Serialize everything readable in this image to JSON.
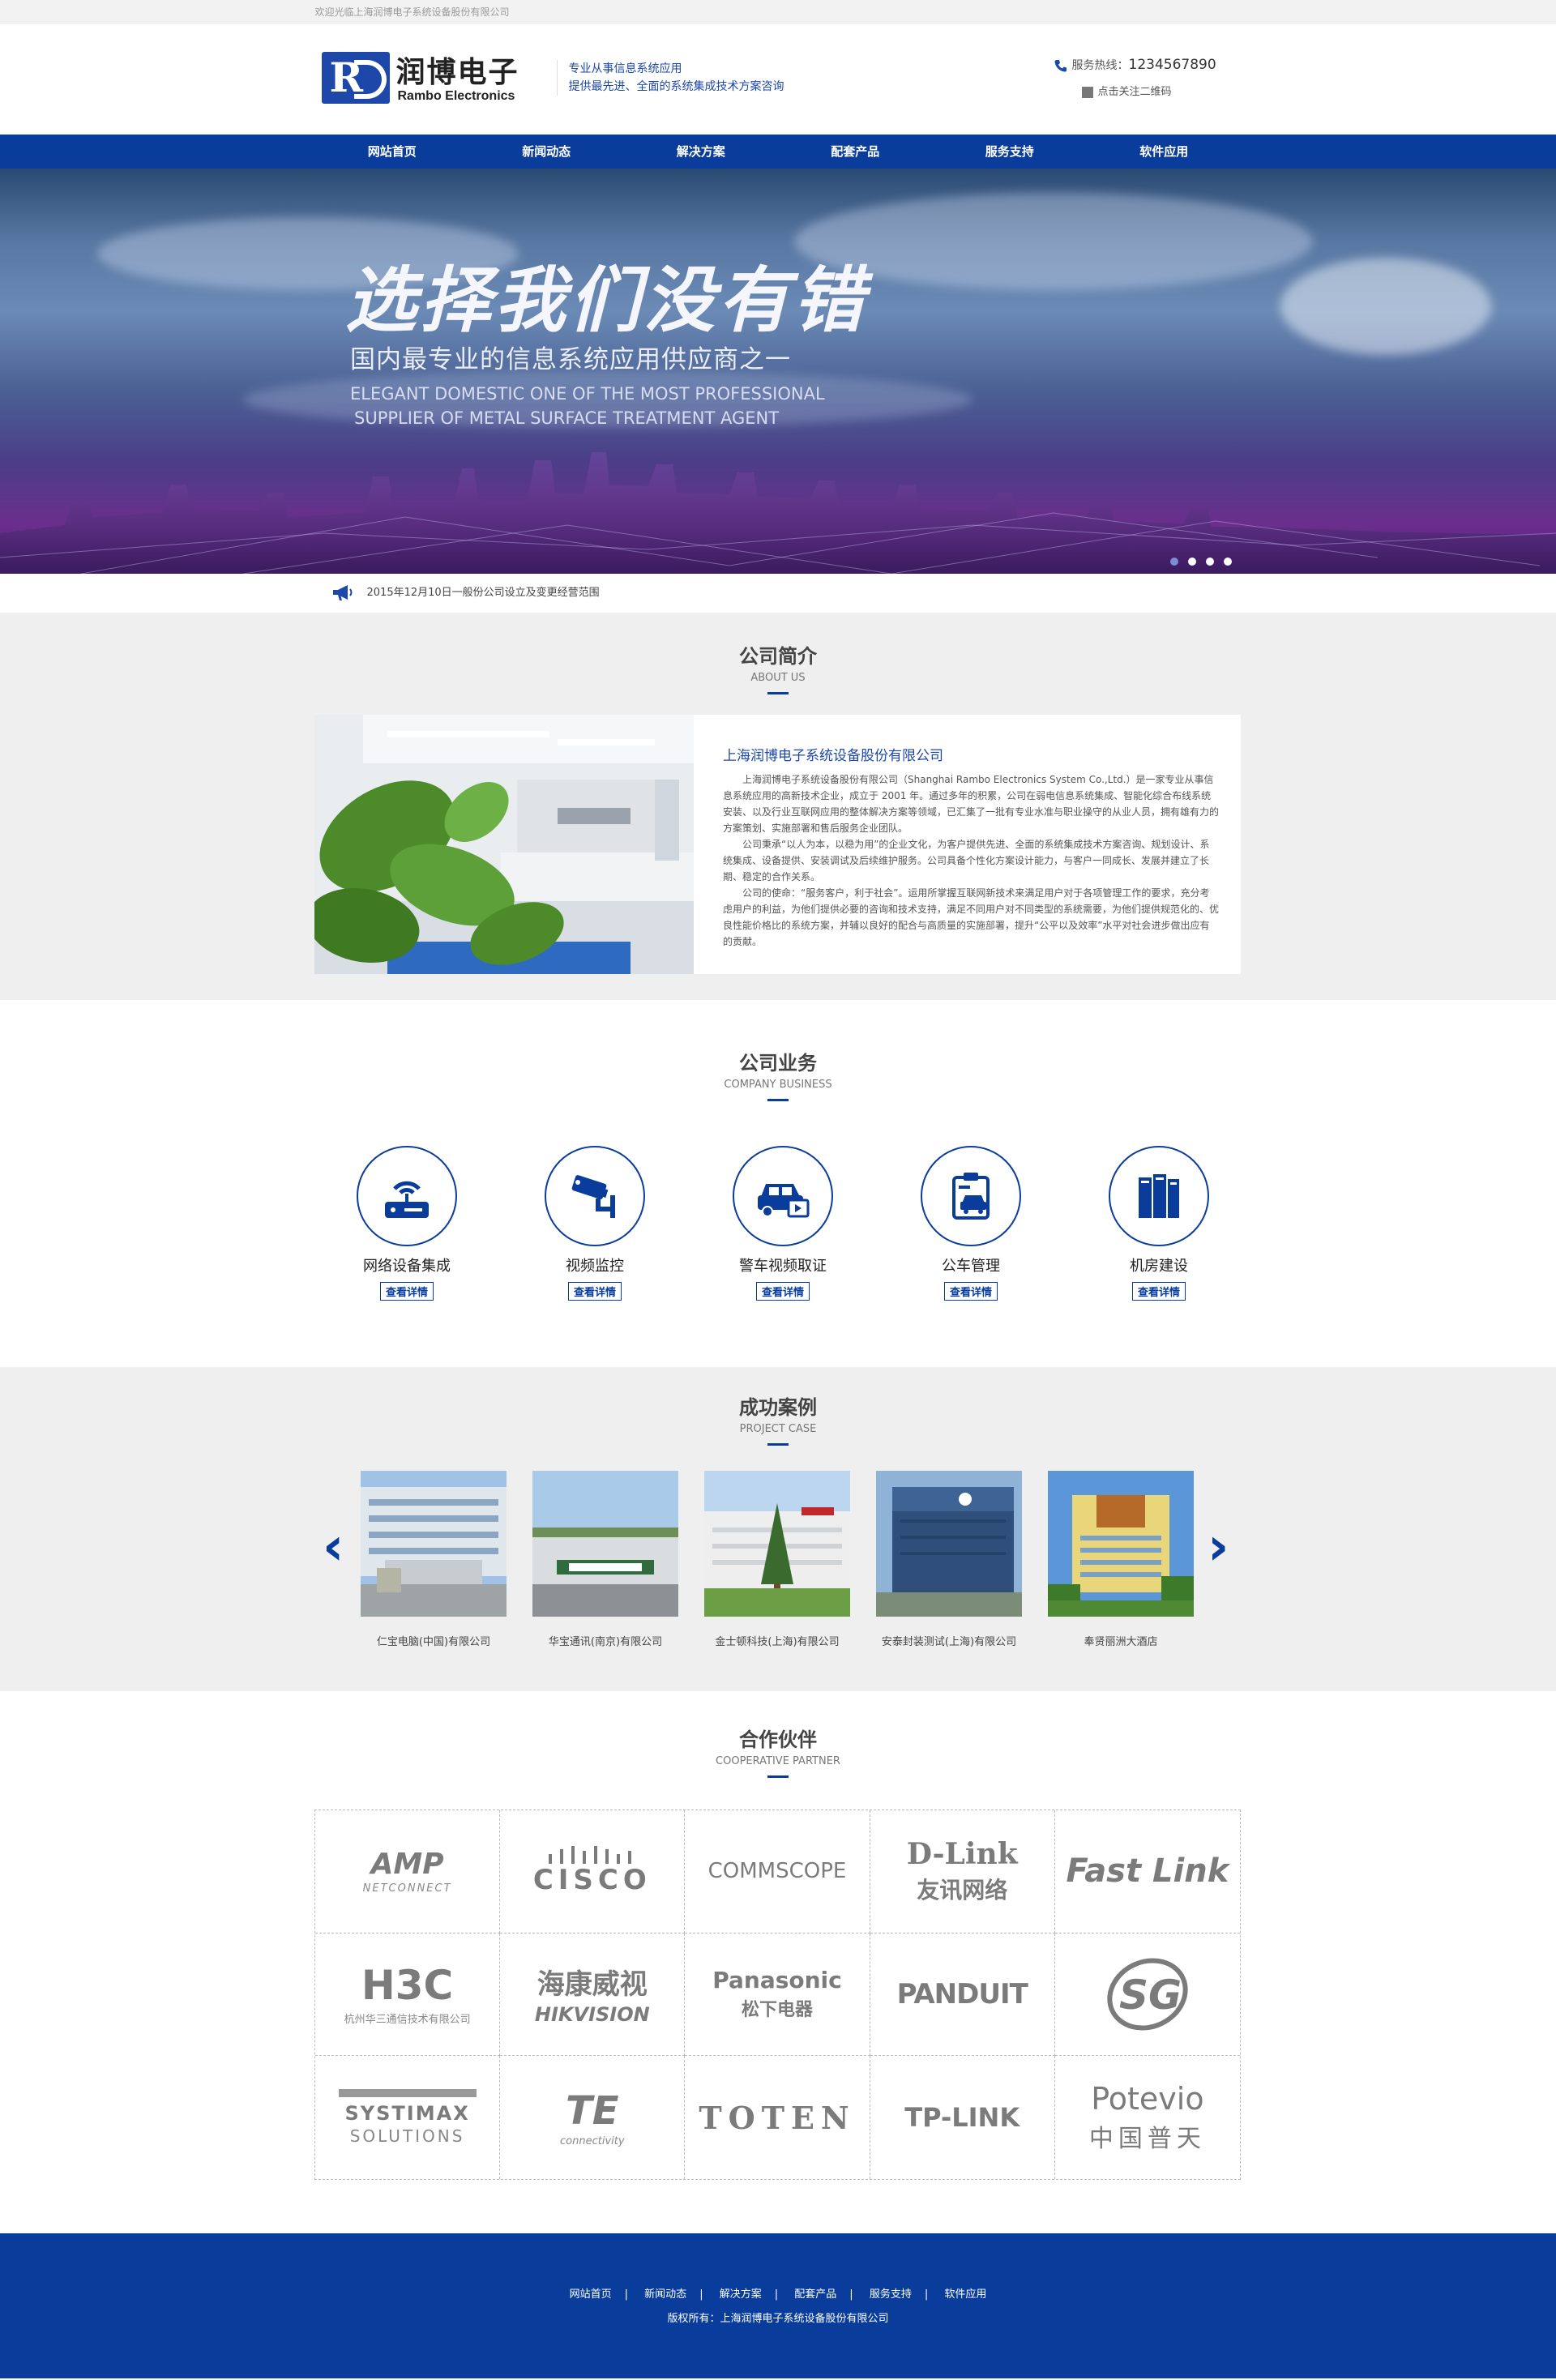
{
  "topbar": {
    "welcome": "欢迎光临上海润博电子系统设备股份有限公司"
  },
  "header": {
    "logo_cn": "润博电子",
    "logo_en": "Rambo Electronics",
    "slogan_1": "专业从事信息系统应用",
    "slogan_2": "提供最先进、全面的系统集成技术方案咨询",
    "hotline_label": "服务热线：",
    "hotline_number": "1234567890",
    "qr_label": "点击关注二维码"
  },
  "nav": [
    {
      "label": "网站首页"
    },
    {
      "label": "新闻动态"
    },
    {
      "label": "解决方案"
    },
    {
      "label": "配套产品"
    },
    {
      "label": "服务支持"
    },
    {
      "label": "软件应用"
    }
  ],
  "banner": {
    "title": "选择我们没有错",
    "subtitle": "国内最专业的信息系统应用供应商之一",
    "en_1": "ELEGANT DOMESTIC ONE OF THE MOST PROFESSIONAL",
    "en_2": "SUPPLIER OF METAL SURFACE TREATMENT AGENT",
    "slides": 4,
    "active_slide": 1
  },
  "notice": {
    "text": "2015年12月10日一般份公司设立及变更经营范围"
  },
  "about": {
    "title_cn": "公司简介",
    "title_en": "ABOUT US",
    "company": "上海润博电子系统设备股份有限公司",
    "p1": "上海润博电子系统设备股份有限公司（Shanghai Rambo Electronics System Co.,Ltd.）是一家专业从事信息系统应用的高新技术企业，成立于 2001 年。通过多年的积累，公司在弱电信息系统集成、智能化综合布线系统安装、以及行业互联网应用的整体解决方案等领域，已汇集了一批有专业水准与职业操守的从业人员，拥有雄有力的方案策划、实施部署和售后服务企业团队。",
    "p2": "公司秉承“以人为本，以稳为用”的企业文化，为客户提供先进、全面的系统集成技术方案咨询、规划设计、系统集成、设备提供、安装调试及后续维护服务。公司具备个性化方案设计能力，与客户一同成长、发展并建立了长期、稳定的合作关系。",
    "p3": "公司的使命：“服务客户，利于社会”。运用所掌握互联网新技术来满足用户对于各项管理工作的要求，充分考虑用户的利益，为他们提供必要的咨询和技术支持，满足不同用户对不同类型的系统需要，为他们提供规范化的、优良性能价格比的系统方案，并辅以良好的配合与高质量的实施部署，提升“公平以及效率”水平对社会进步做出应有的贡献。"
  },
  "business": {
    "title_cn": "公司业务",
    "title_en": "COMPANY BUSINESS",
    "button": "查看详情",
    "items": [
      {
        "label": "网络设备集成",
        "icon": "router-icon"
      },
      {
        "label": "视频监控",
        "icon": "cctv-camera-icon"
      },
      {
        "label": "警车视频取证",
        "icon": "police-car-icon"
      },
      {
        "label": "公车管理",
        "icon": "vehicle-clipboard-icon"
      },
      {
        "label": "机房建设",
        "icon": "server-rack-icon"
      }
    ]
  },
  "cases": {
    "title_cn": "成功案例",
    "title_en": "PROJECT CASE",
    "prev": "‹",
    "next": "›",
    "items": [
      {
        "name": "仁宝电脑(中国)有限公司"
      },
      {
        "name": "华宝通讯(南京)有限公司"
      },
      {
        "name": "金士顿科技(上海)有限公司"
      },
      {
        "name": "安泰封装测试(上海)有限公司"
      },
      {
        "name": "奉贤丽洲大酒店"
      }
    ]
  },
  "partners": {
    "title_cn": "合作伙伴",
    "title_en": "COOPERATIVE PARTNER",
    "items": [
      {
        "name": "AMP",
        "sub": "NETCONNECT"
      },
      {
        "name": "CISCO",
        "sub": ""
      },
      {
        "name": "COMMSCOPE",
        "sub": ""
      },
      {
        "name": "D-Link",
        "sub": "友讯网络"
      },
      {
        "name": "Fast Link",
        "sub": ""
      },
      {
        "name": "H3C",
        "sub": "杭州华三通信技术有限公司"
      },
      {
        "name": "海康威视",
        "sub": "HIKVISION"
      },
      {
        "name": "Panasonic",
        "sub": "松下电器"
      },
      {
        "name": "PANDUIT",
        "sub": ""
      },
      {
        "name": "SG",
        "sub": ""
      },
      {
        "name": "SYSTIMAX",
        "sub": "SOLUTIONS"
      },
      {
        "name": "TE",
        "sub": "connectivity"
      },
      {
        "name": "TOTEN",
        "sub": ""
      },
      {
        "name": "TP-LINK",
        "sub": ""
      },
      {
        "name": "Potevio",
        "sub": "中国普天"
      }
    ]
  },
  "footer": {
    "links": [
      "网站首页",
      "新闻动态",
      "解决方案",
      "配套产品",
      "服务支持",
      "软件应用"
    ],
    "copyright": "版权所有：上海润博电子系统设备股份有限公司"
  }
}
